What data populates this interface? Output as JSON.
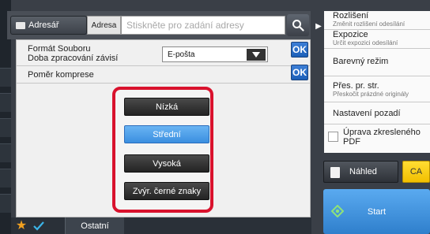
{
  "topbar": {
    "addressbook_label": "Adresář",
    "address_label": "Adresa",
    "address_placeholder": "Stiskněte pro zadání adresy"
  },
  "panel": {
    "format_label_line1": "Formát Souboru",
    "format_label_line2": "Doba zpracování závisí",
    "format_value": "E-pošta",
    "ok_label": "OK",
    "compression_label": "Poměr komprese",
    "compression_options": [
      "Nízká",
      "Střední",
      "Vysoká",
      "Zvýr. černé znaky"
    ],
    "compression_selected": "Střední"
  },
  "bottom": {
    "other_label": "Ostatní"
  },
  "right_menu": {
    "items": [
      {
        "title": "Rozlišení",
        "subtitle": "Změnit rozlišení odesílání"
      },
      {
        "title": "Expozice",
        "subtitle": "Určit expozici odesílání"
      },
      {
        "title": "Barevný režim",
        "subtitle": ""
      },
      {
        "title": "Přes. pr. str.",
        "subtitle": "Přeskočit prázdné originály"
      },
      {
        "title": "Nastavení pozadí",
        "subtitle": ""
      }
    ],
    "checkbox_label_line1": "Úprava zkresleného",
    "checkbox_label_line2": "PDF"
  },
  "actions": {
    "preview_label": "Náhled",
    "ca_label": "CA",
    "start_label": "Start"
  },
  "colors": {
    "accent_blue": "#3b8fe0",
    "highlight_red": "#d9122d",
    "ca_yellow": "#f2bf00",
    "ok_blue": "#1b5fb8"
  }
}
